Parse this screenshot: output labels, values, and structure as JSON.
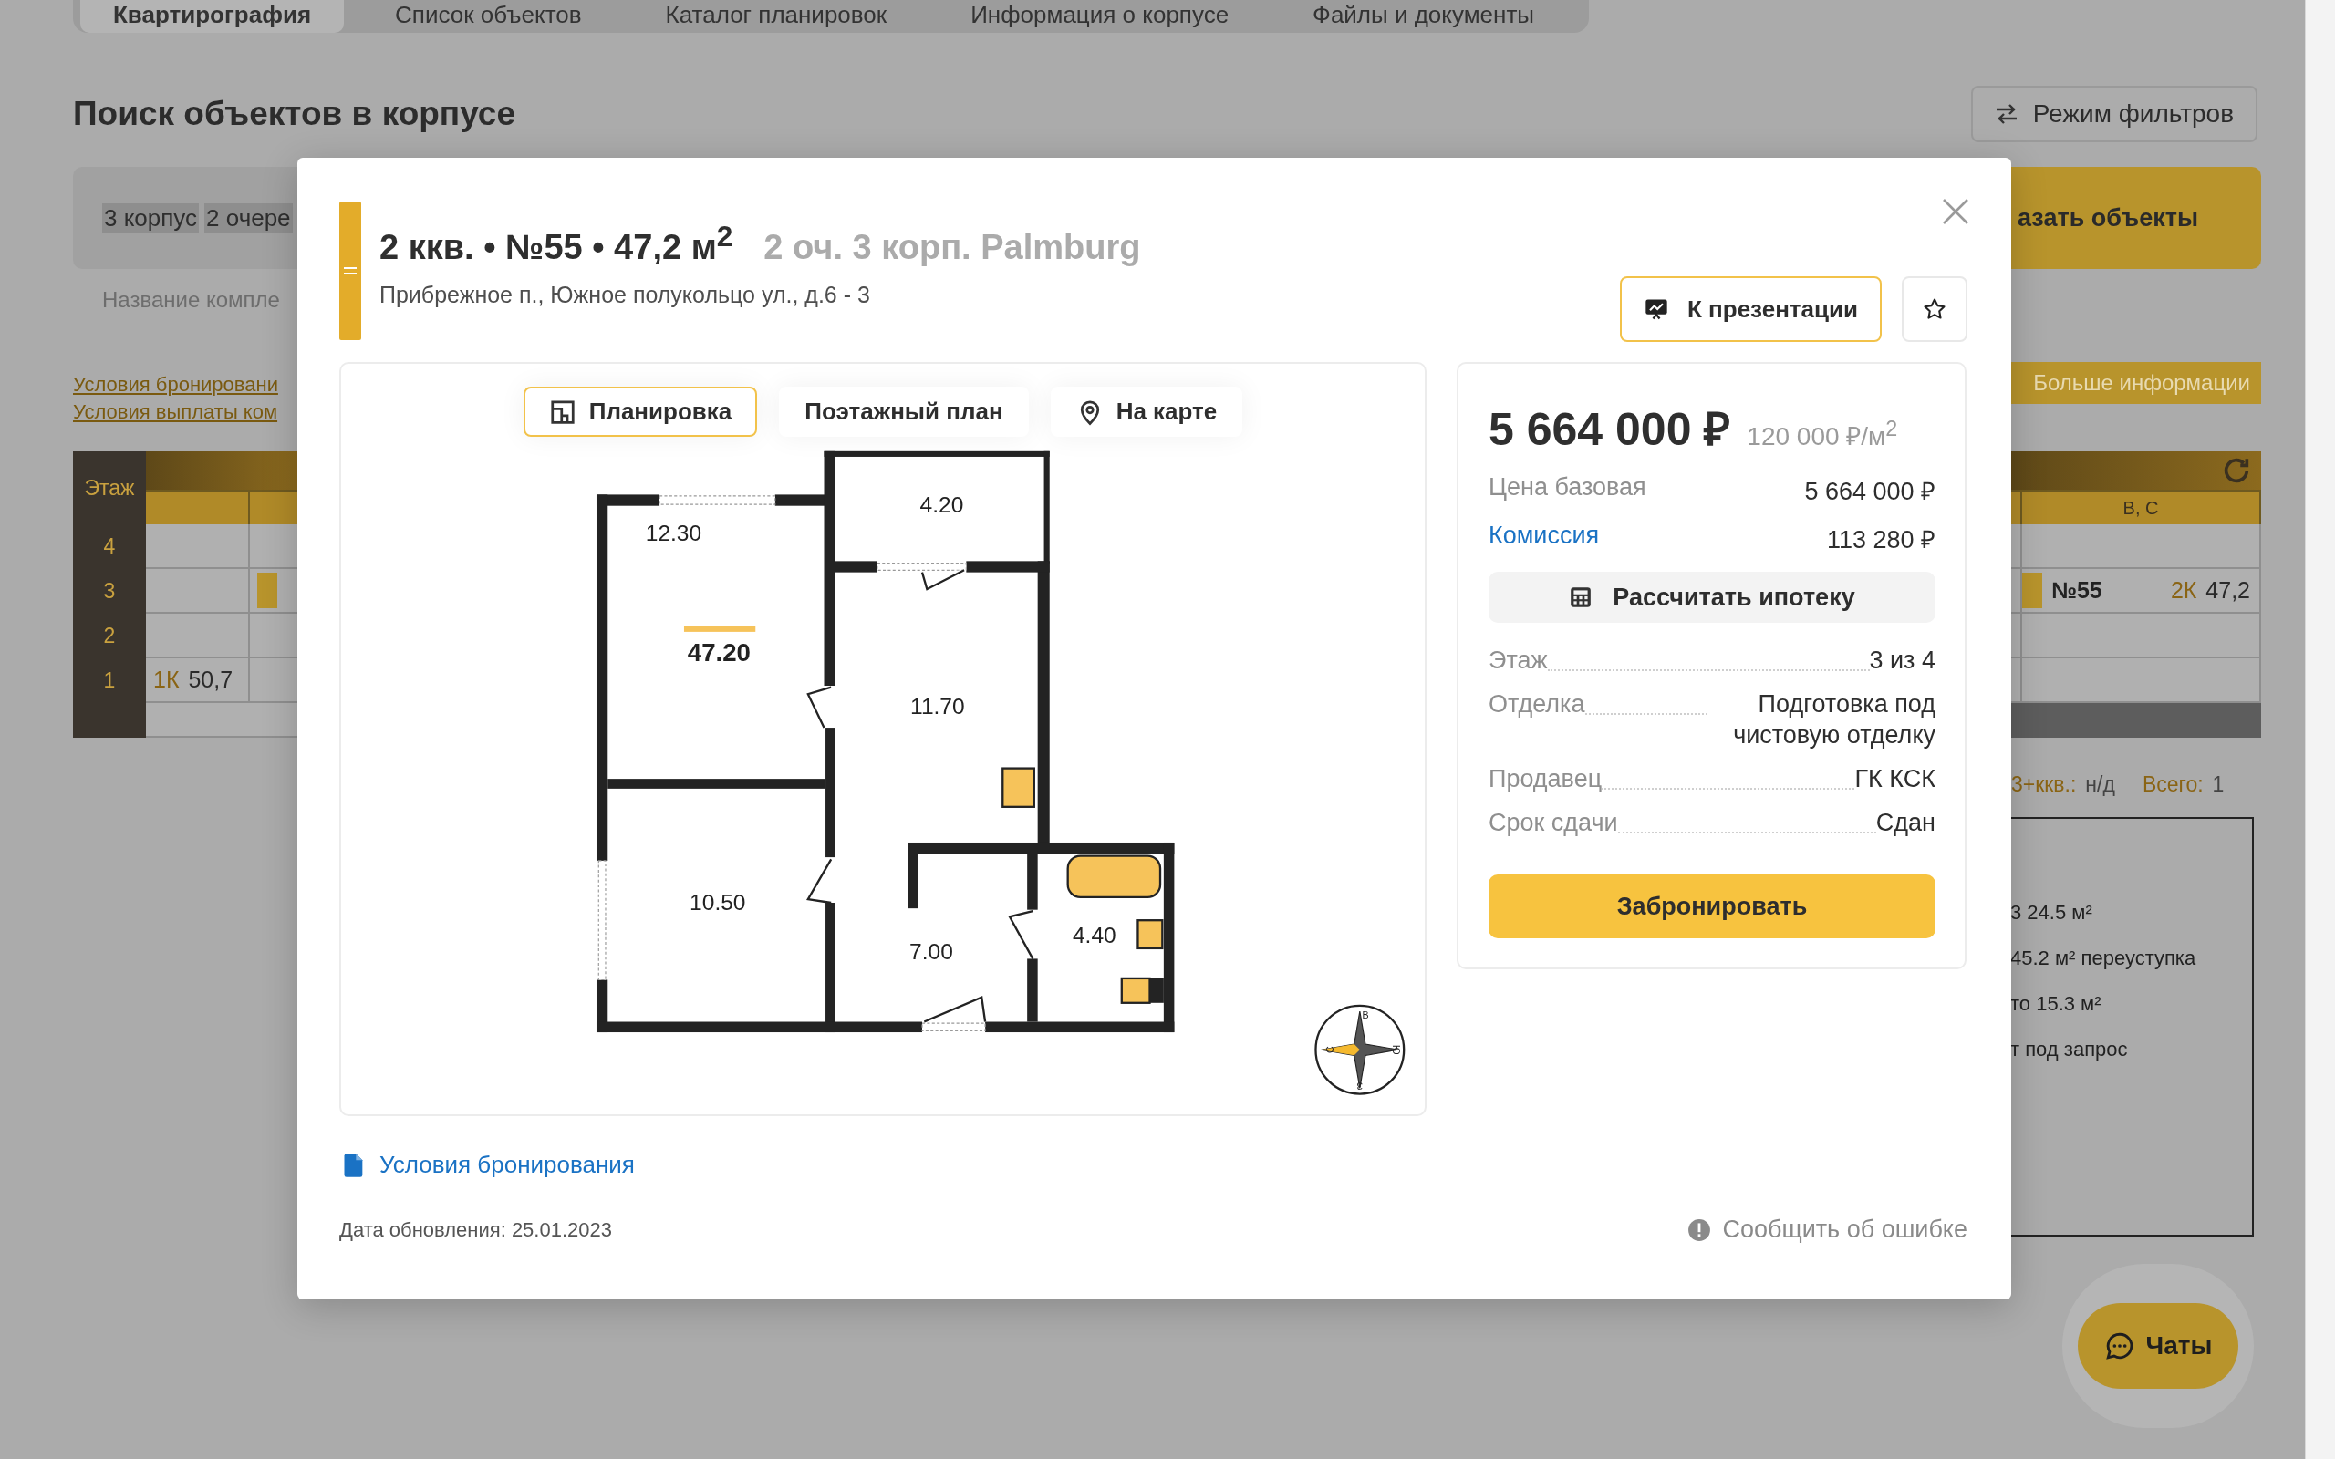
{
  "background": {
    "tabs": [
      {
        "label": "Квартирография",
        "selected": true
      },
      {
        "label": "Список объектов",
        "selected": false
      },
      {
        "label": "Каталог планировок",
        "selected": false
      },
      {
        "label": "Информация о корпусе",
        "selected": false
      },
      {
        "label": "Файлы и документы",
        "selected": false
      }
    ],
    "title": "Поиск объектов в корпусе",
    "filter_mode_button": "Режим фильтров",
    "filter_chips": [
      "3 корпус",
      "2 очере"
    ],
    "show_button": "азать объекты",
    "complex_name_label": "Название компле",
    "links": [
      "Условия бронировани",
      "Условия выплаты ком"
    ],
    "more_info_button": "Больше информации",
    "table": {
      "floor_header": "Этаж",
      "column_header": "В, С",
      "floors": [
        {
          "floor": "4",
          "cells": [
            {
              "kind": "empty"
            },
            {
              "kind": "empty"
            },
            {
              "kind": "empty"
            }
          ]
        },
        {
          "floor": "3",
          "cells": [
            {
              "kind": "empty"
            },
            {
              "kind": "marked"
            },
            {
              "kind": "unit",
              "number": "№55",
              "rooms": "2К",
              "area": "47,2"
            }
          ]
        },
        {
          "floor": "2",
          "cells": [
            {
              "kind": "empty"
            },
            {
              "kind": "empty"
            },
            {
              "kind": "empty"
            }
          ]
        },
        {
          "floor": "1",
          "cells": [
            {
              "kind": "unit",
              "rooms": "1К",
              "area": "50,7"
            },
            {
              "kind": "empty"
            },
            {
              "kind": "empty"
            }
          ]
        }
      ]
    },
    "stats": [
      {
        "label": "3+ккв.:",
        "value": "н/д"
      },
      {
        "label": "Всего:",
        "value": "1"
      }
    ],
    "notes": [
      "3 24.5 м²",
      "45.2 м² переуступка",
      "то 15.3 м²",
      "т под запрос"
    ],
    "chat_button": "Чаты"
  },
  "modal": {
    "title": "2 ккв. • №55 • 47,2 м$^{2}$",
    "subtitle": "2 оч. 3 корп. Palmburg",
    "address": "Прибрежное п., Южное полукольцо ул., д.6 - 3",
    "presentation_button": "К презентации",
    "favorite": false,
    "view_tabs": [
      {
        "label": "Планировка",
        "selected": true,
        "kind": "plan"
      },
      {
        "label": "Поэтажный план",
        "selected": false,
        "kind": "text"
      },
      {
        "label": "На карте",
        "selected": false,
        "kind": "map"
      }
    ],
    "plan": {
      "total_area": "47.20",
      "rooms": [
        "12.30",
        "4.20",
        "11.70",
        "10.50",
        "7.00",
        "4.40"
      ],
      "compass": [
        "С",
        "В",
        "Ю",
        "З"
      ]
    },
    "price": "5 664 000 ₽",
    "price_per_m2": "120 000 ₽/м$^{2}$",
    "price_rows": [
      {
        "label": "Цена базовая",
        "value": "5 664 000 ₽",
        "kind": "plain"
      },
      {
        "label": "Комиссия",
        "value": "113 280 ₽",
        "kind": "link"
      }
    ],
    "mortgage_button": "Рассчитать ипотеку",
    "details": [
      {
        "label": "Этаж",
        "value": "3 из 4"
      },
      {
        "label": "Отделка",
        "value": "Подготовка под чистовую отделку"
      },
      {
        "label": "Продавец",
        "value": "ГК КСК"
      },
      {
        "label": "Срок сдачи",
        "value": "Сдан"
      }
    ],
    "book_button": "Забронировать",
    "booking_terms_link": "Условия бронирования",
    "updated": "Дата обновления: 25.01.2023",
    "report_error": "Сообщить об ошибке"
  }
}
